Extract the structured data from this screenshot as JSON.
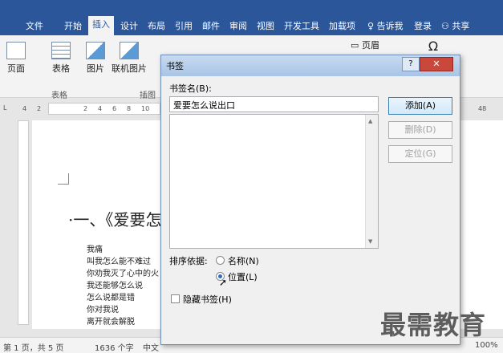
{
  "tabs": {
    "file": "文件",
    "home": "开始",
    "insert": "插入",
    "design": "设计",
    "layout": "布局",
    "references": "引用",
    "mailings": "邮件",
    "review": "审阅",
    "view": "视图",
    "developer": "开发工具",
    "addins": "加载项",
    "tell": "告诉我",
    "login": "登录",
    "share": "共享"
  },
  "ribbon": {
    "pages": "页面",
    "table": "表格",
    "picture": "图片",
    "online_picture": "联机图片",
    "group_table": "表格",
    "group_illustrations": "插图",
    "header": "页眉",
    "omega": "Ω"
  },
  "ruler": {
    "marks": [
      "4",
      "2",
      "2",
      "4",
      "6",
      "8",
      "10",
      "48"
    ]
  },
  "document": {
    "heading": "·一、《爱要怎",
    "lines": [
      "我痛",
      "叫我怎么能不难过",
      "你劝我灭了心中的火",
      "我还能够怎么说",
      "怎么说都是错",
      "你对我说",
      "离开就会解脱"
    ]
  },
  "statusbar": {
    "page": "第 1 页，共 5 页",
    "words": "1636 个字",
    "lang": "中文",
    "zoom": "100%"
  },
  "dialog": {
    "title": "书签",
    "help": "?",
    "close": "✕",
    "name_label": "书签名(B):",
    "name_value": "爱要怎么说出口",
    "add": "添加(A)",
    "delete": "删除(D)",
    "goto": "定位(G)",
    "sort_label": "排序依据:",
    "sort_name": "名称(N)",
    "sort_location": "位置(L)",
    "hidden": "隐藏书签(H)"
  },
  "watermark": "最需教育"
}
